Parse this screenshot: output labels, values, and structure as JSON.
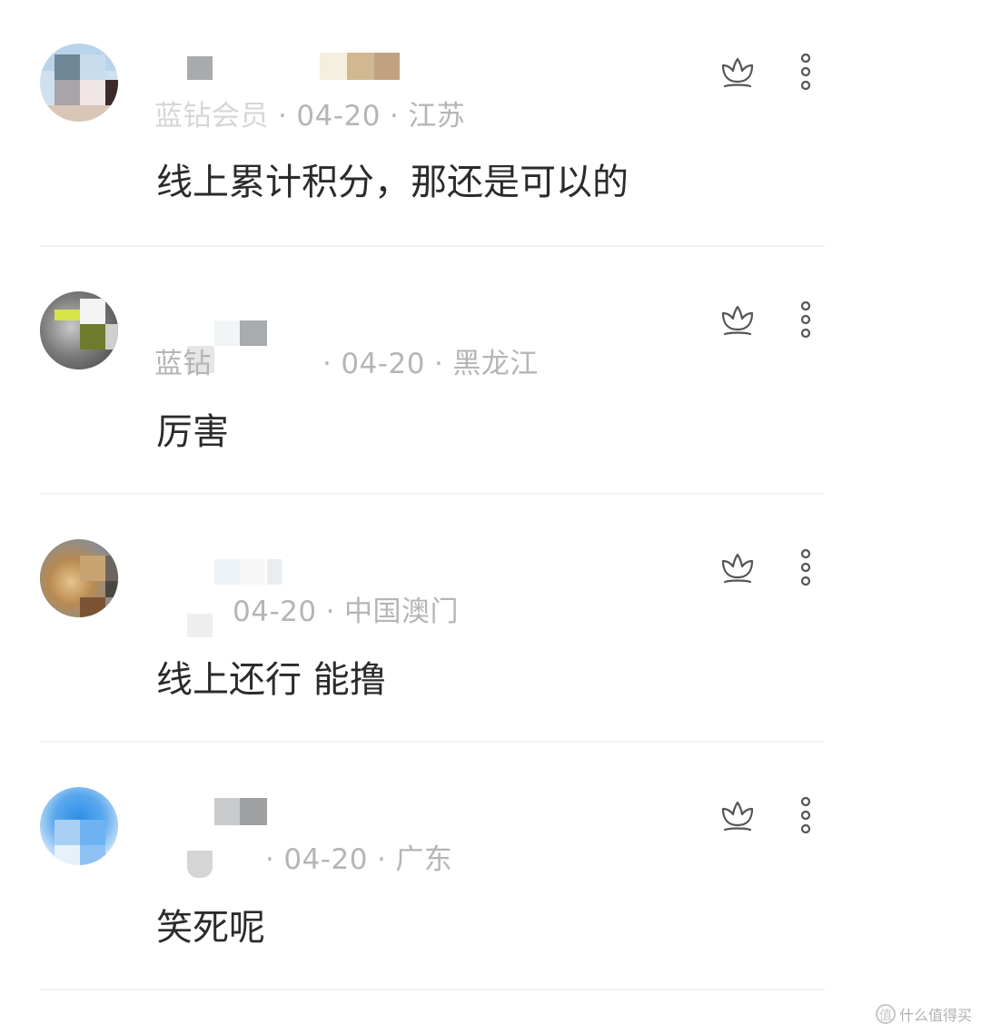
{
  "comments": [
    {
      "meta_prefix": "蓝钻会员",
      "date": "04-20",
      "location": "江苏",
      "text": "线上累计积分，那还是可以的"
    },
    {
      "meta_prefix": "蓝钻",
      "date": "04-20",
      "location": "黑龙江",
      "text": "厉害"
    },
    {
      "meta_prefix": "",
      "date": "04-20",
      "location": "中国澳门",
      "text": "线上还行 能撸"
    },
    {
      "meta_prefix": "",
      "date": "04-20",
      "location": "广东",
      "text": "笑死呢"
    }
  ],
  "meta_separator": "·",
  "icons": {
    "like": "lotus-like-icon",
    "more": "vertical-dots-more-icon"
  },
  "watermark": {
    "logo_char": "值",
    "text": "什么值得买"
  },
  "colors": {
    "meta": "#b5b5b5",
    "body": "#2b2b2b",
    "divider": "#f2f2f2",
    "icon": "#555555"
  }
}
